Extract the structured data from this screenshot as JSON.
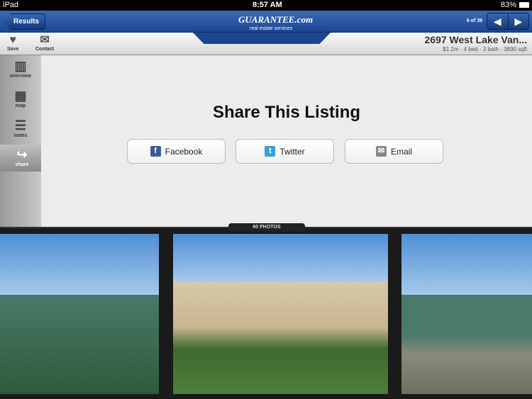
{
  "status": {
    "device": "iPad",
    "time": "8:57 AM",
    "battery": "83%"
  },
  "nav": {
    "back": "Results",
    "count": "6 of 39",
    "prev": "◀",
    "next": "▶",
    "logo": "GUARANTEE.com",
    "logo_sub": "real estate services"
  },
  "toolbar": {
    "save": "Save",
    "contact": "Contact"
  },
  "listing": {
    "address": "2697 West Lake Van...",
    "summary": "$1.2m · 4 bed · 3 bath · 3890 sqft"
  },
  "sidebar": {
    "items": [
      {
        "label": "overview"
      },
      {
        "label": "map"
      },
      {
        "label": "notes"
      },
      {
        "label": "share"
      }
    ]
  },
  "share": {
    "title": "Share This Listing",
    "facebook": "Facebook",
    "twitter": "Twitter",
    "email": "Email"
  },
  "photos": {
    "label": "60 PHOTOS"
  }
}
